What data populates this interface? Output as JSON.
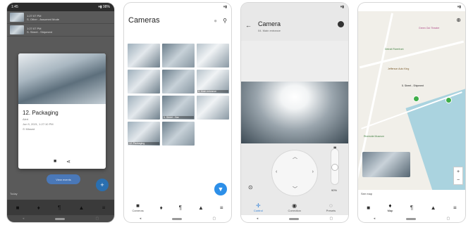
{
  "status": {
    "p1_time": "1:45",
    "p1_batt": "98%",
    "batt_icon": "▾▮"
  },
  "panel1": {
    "rows": [
      {
        "time": "1:27:07 PM",
        "label": "S. Other - Assumed Mode"
      },
      {
        "time": "1:27:07 PM",
        "label": "S. Street - Shipment"
      }
    ],
    "detail": {
      "title": "12. Packaging",
      "alert": "Alert",
      "date": "Jun 9, 2021, 1:27:10 PM",
      "status": "Missed"
    },
    "pill_button": "View events",
    "footer_text": "Today"
  },
  "panel2": {
    "title": "Cameras",
    "cells": [
      "",
      "",
      "",
      "",
      "",
      "8. Main entrance",
      "",
      "5. Street - Bar",
      "",
      "12. Packaging",
      "",
      ""
    ]
  },
  "panel3": {
    "title": "Camera",
    "subtitle": "04. Main entrance",
    "zoom_pct": "90%",
    "tabs": [
      {
        "icon": "✛",
        "label": "Control",
        "active": true
      },
      {
        "icon": "◉",
        "label": "Correction",
        "active": false
      },
      {
        "icon": "◌",
        "label": "Presets",
        "active": false
      }
    ]
  },
  "panel4": {
    "pois": [
      {
        "text": "Green Out Theatre",
        "color": "#b04e8a"
      },
      {
        "text": "Detroit Riverfront",
        "color": "#3f7f3f"
      },
      {
        "text": "Jefferson Auto King",
        "color": "#7a5a2a"
      },
      {
        "text": "5. Street - Shipment",
        "color": "#222222"
      },
      {
        "text": "Riverside Museum",
        "color": "#3f7f3f"
      }
    ],
    "footer": "See map"
  },
  "tabbar": {
    "cameras": "Cameras",
    "map": "Map"
  }
}
